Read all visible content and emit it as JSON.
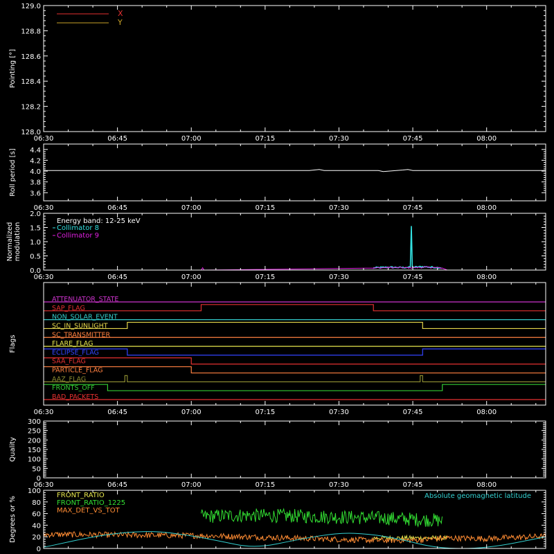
{
  "colors": {
    "background": "#000000",
    "axes": "#ffffff",
    "flag_label": "#ff2d2d",
    "quality": "#ffffff"
  },
  "chart_data": [
    {
      "type": "line",
      "ylabel": "Pointing [°]",
      "ylim": [
        128.0,
        129.0
      ],
      "yticks": [
        "128.0",
        "128.2",
        "128.4",
        "128.6",
        "128.8",
        "129.0"
      ],
      "x_range": [
        "06:30",
        "08:12"
      ],
      "xticks": [
        "06:30",
        "06:45",
        "07:00",
        "07:15",
        "07:30",
        "07:45",
        "08:00"
      ],
      "legend_placement": "top-left",
      "series": [
        {
          "name": "X",
          "color": "#e53030",
          "x": [
            "06:30",
            "08:12"
          ],
          "values": [
            128.0,
            128.0
          ]
        },
        {
          "name": "Y",
          "color": "#c9a227",
          "x": [
            "06:30",
            "08:12"
          ],
          "values": [
            128.0,
            128.0
          ]
        }
      ]
    },
    {
      "type": "line",
      "ylabel": "Roll period [s]",
      "ylim": [
        3.45,
        4.5
      ],
      "yticks": [
        "3.6",
        "3.8",
        "4.0",
        "4.2",
        "4.4"
      ],
      "x_range": [
        "06:30",
        "08:12"
      ],
      "xticks": [
        "06:30",
        "06:45",
        "07:00",
        "07:15",
        "07:30",
        "07:45",
        "08:00"
      ],
      "series": [
        {
          "name": "",
          "color": "#ffffff",
          "x": [
            "06:30",
            "07:24",
            "07:26",
            "07:27",
            "07:38",
            "07:39",
            "07:43",
            "07:44",
            "07:45",
            "08:12"
          ],
          "values": [
            4.01,
            4.01,
            4.03,
            4.01,
            4.01,
            3.99,
            4.02,
            4.03,
            4.01,
            4.01
          ]
        }
      ]
    },
    {
      "type": "line",
      "ylabel": "Normalized modulation",
      "ylim": [
        0,
        2.0
      ],
      "yticks": [
        "0.0",
        "0.5",
        "1.0",
        "1.5",
        "2.0"
      ],
      "x_range": [
        "06:30",
        "08:12"
      ],
      "xticks": [
        "06:30",
        "06:45",
        "07:00",
        "07:15",
        "07:30",
        "07:45",
        "08:00"
      ],
      "annotations": [
        "Energy band: 12-25 keV"
      ],
      "legend_placement": "top-left",
      "series": [
        {
          "name": "Collimator 8",
          "color": "#33e0e0",
          "x": [
            "07:37",
            "07:40",
            "07:43",
            "07:44.5",
            "07:44.7",
            "07:44.9",
            "07:47",
            "07:51"
          ],
          "values": [
            0.08,
            0.1,
            0.09,
            0.1,
            1.55,
            0.1,
            0.12,
            0.08
          ]
        },
        {
          "name": "Collimator 9",
          "color": "#e020e0",
          "x": [
            "06:30",
            "07:02",
            "07:02.3",
            "07:02.6",
            "07:37",
            "07:40",
            "07:44",
            "07:48",
            "07:51",
            "07:52",
            "08:12"
          ],
          "values": [
            0.0,
            0.0,
            0.08,
            0.0,
            0.07,
            0.09,
            0.08,
            0.1,
            0.07,
            0.0,
            0.0
          ]
        }
      ]
    },
    {
      "type": "line",
      "ylabel": "Flags",
      "x_range": [
        "06:30",
        "08:12"
      ],
      "xticks": [
        "06:30",
        "06:45",
        "07:00",
        "07:15",
        "07:30",
        "07:45",
        "08:00"
      ],
      "flags": [
        {
          "name": "ATTENUATOR_STATE",
          "color": "#cc33cc",
          "steps": [
            [
              "06:30",
              0
            ]
          ]
        },
        {
          "name": "SAP_FLAG",
          "color": "#e53030",
          "steps": [
            [
              "06:30",
              0
            ],
            [
              "07:02",
              1
            ],
            [
              "07:37",
              0
            ]
          ]
        },
        {
          "name": "NON_SOLAR_EVENT",
          "color": "#33cccc",
          "steps": [
            [
              "06:30",
              0
            ]
          ]
        },
        {
          "name": "SC_IN_SUNLIGHT",
          "color": "#e6d84c",
          "steps": [
            [
              "06:30",
              0
            ],
            [
              "06:47",
              1
            ],
            [
              "07:47",
              0
            ]
          ]
        },
        {
          "name": "SC_TRANSMITTER",
          "color": "#ff8040",
          "steps": [
            [
              "06:30",
              0
            ]
          ]
        },
        {
          "name": "FLARE_FLAG",
          "color": "#e6e64c",
          "steps": [
            [
              "06:30",
              0
            ]
          ]
        },
        {
          "name": "ECLIPSE_FLAG",
          "color": "#3344ff",
          "steps": [
            [
              "06:30",
              1
            ],
            [
              "06:47",
              0
            ],
            [
              "07:47",
              1
            ]
          ]
        },
        {
          "name": "SAA_FLAG",
          "color": "#e53030",
          "steps": [
            [
              "06:30",
              1
            ],
            [
              "07:00",
              0
            ]
          ]
        },
        {
          "name": "PARTICLE_FLAG",
          "color": "#ff8040",
          "steps": [
            [
              "06:30",
              1
            ],
            [
              "07:00",
              0
            ]
          ]
        },
        {
          "name": "AAZ_FLAG",
          "color": "#8a8a30",
          "steps": [
            [
              "06:30",
              0
            ],
            [
              "06:46.5",
              1
            ],
            [
              "06:47",
              0
            ],
            [
              "07:46.5",
              1
            ],
            [
              "07:47",
              0
            ]
          ]
        },
        {
          "name": "FRONTS_OFF",
          "color": "#33cc33",
          "steps": [
            [
              "06:30",
              1
            ],
            [
              "06:43",
              0
            ],
            [
              "07:51",
              1
            ]
          ]
        },
        {
          "name": "BAD_PACKETS",
          "color": "#e53030",
          "steps": [
            [
              "06:30",
              0
            ]
          ]
        }
      ]
    },
    {
      "type": "line",
      "ylabel": "Quality",
      "ylim": [
        0,
        300
      ],
      "yticks": [
        "0",
        "50",
        "100",
        "150",
        "200",
        "250",
        "300"
      ],
      "x_range": [
        "06:30",
        "08:12"
      ],
      "xticks": [
        "06:30",
        "06:45",
        "07:00",
        "07:15",
        "07:30",
        "07:45",
        "08:00"
      ],
      "series": []
    },
    {
      "type": "line",
      "ylabel": "Degrees or %",
      "ylim": [
        0,
        100
      ],
      "yticks": [
        "0",
        "20",
        "40",
        "60",
        "80",
        "100"
      ],
      "x_range": [
        "06:30",
        "08:12"
      ],
      "annotations": [
        "Absolute geomagnetic latitude"
      ],
      "legend_placement": "top-left",
      "series": [
        {
          "name": "FRONT_RATIO",
          "color": "#e6e64c",
          "x": [
            "07:37",
            "07:52"
          ],
          "values": [
            18,
            18
          ]
        },
        {
          "name": "FRONT_RATIO_1225",
          "color": "#33e033",
          "x": [
            "07:02",
            "07:10",
            "07:20",
            "07:30",
            "07:40",
            "07:51"
          ],
          "values": [
            55,
            57,
            56,
            54,
            52,
            48
          ]
        },
        {
          "name": "MAX_DET_VS_TOT",
          "color": "#ff8c33",
          "x": [
            "06:30",
            "06:34",
            "07:02",
            "07:03",
            "07:37",
            "07:45",
            "07:52",
            "08:00",
            "08:12"
          ],
          "values": [
            24,
            24,
            22,
            22,
            14,
            14,
            18,
            17,
            21
          ]
        },
        {
          "name": "Absolute geomagnetic latitude",
          "color": "#33d0d0",
          "x": [
            "06:30",
            "06:42",
            "06:52",
            "07:00",
            "07:05",
            "07:13",
            "07:22",
            "07:30",
            "07:36",
            "07:42",
            "07:50",
            "08:00",
            "08:12"
          ],
          "values": [
            2,
            24,
            31,
            22,
            14,
            0,
            16,
            27,
            25,
            17,
            0,
            0,
            20
          ]
        }
      ]
    }
  ]
}
